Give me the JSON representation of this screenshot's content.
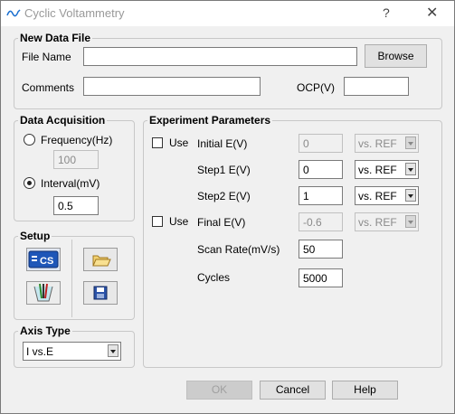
{
  "window": {
    "title": "Cyclic Voltammetry",
    "help_label": "?",
    "close_label": "✕"
  },
  "new_data_file": {
    "legend": "New Data File",
    "file_name_label": "File Name",
    "file_name_value": "",
    "browse_label": "Browse",
    "comments_label": "Comments",
    "comments_value": "",
    "ocp_label": "OCP(V)",
    "ocp_value": ""
  },
  "data_acquisition": {
    "legend": "Data Acquisition",
    "frequency_label": "Frequency(Hz)",
    "frequency_value": "100",
    "frequency_selected": false,
    "interval_label": "Interval(mV)",
    "interval_value": "0.5",
    "interval_selected": true
  },
  "setup": {
    "legend": "Setup",
    "tools": [
      "cs-icon",
      "electrode-icon",
      "open-folder-icon",
      "save-icon"
    ]
  },
  "axis_type": {
    "legend": "Axis Type",
    "selected": "I vs.E"
  },
  "experiment_parameters": {
    "legend": "Experiment Parameters",
    "initial": {
      "use_label": "Use",
      "use_checked": false,
      "label": "Initial E(V)",
      "value": "0",
      "ref": "vs. REF"
    },
    "step1": {
      "label": "Step1 E(V)",
      "value": "0",
      "ref": "vs. REF"
    },
    "step2": {
      "label": "Step2 E(V)",
      "value": "1",
      "ref": "vs. REF"
    },
    "final": {
      "use_label": "Use",
      "use_checked": false,
      "label": "Final E(V)",
      "value": "-0.6",
      "ref": "vs. REF"
    },
    "scan_rate": {
      "label": "Scan Rate(mV/s)",
      "value": "50"
    },
    "cycles": {
      "label": "Cycles",
      "value": "5000"
    }
  },
  "footer": {
    "ok_label": "OK",
    "cancel_label": "Cancel",
    "help_label": "Help"
  }
}
